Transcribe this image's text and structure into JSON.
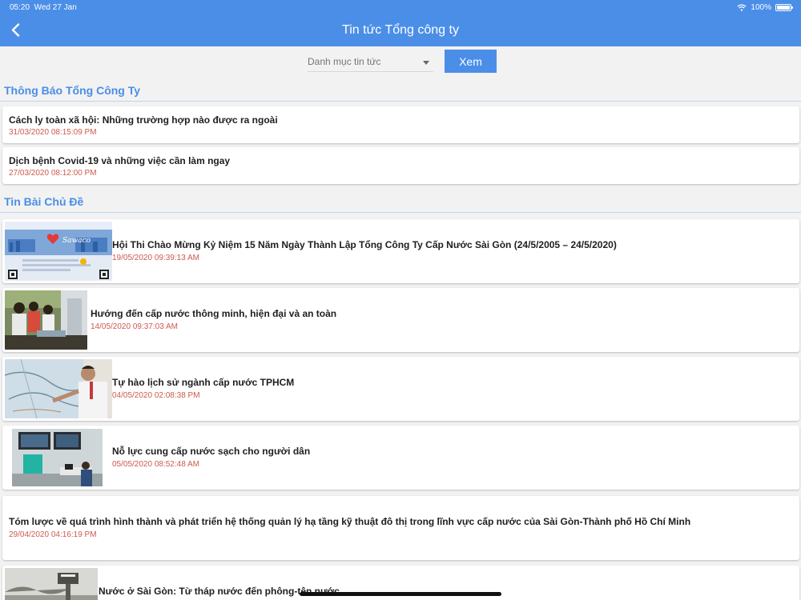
{
  "status": {
    "time": "05:20",
    "date": "Wed 27 Jan",
    "battery": "100%",
    "battery_level": 1.0
  },
  "nav": {
    "title": "Tin tức Tổng công ty"
  },
  "filter": {
    "category_placeholder": "Danh mục tin tức",
    "view_label": "Xem"
  },
  "notice_section": {
    "title": "Thông Báo Tổng Công Ty",
    "items": [
      {
        "title": "Cách ly toàn xã hội: Những trường hợp nào được ra ngoài",
        "date": "31/03/2020 08:15:09 PM"
      },
      {
        "title": "Dịch bệnh Covid-19 và những việc cần làm ngay",
        "date": "27/03/2020 08:12:00 PM"
      }
    ]
  },
  "topic_section": {
    "title": "Tin Bài Chủ Đề",
    "items": [
      {
        "title": "Hội Thi Chào Mừng Kỷ Niệm 15 Năm Ngày Thành Lập Tổng Công Ty Cấp Nước Sài Gòn (24/5/2005 – 24/5/2020)",
        "date": "19/05/2020 09:39:13 AM",
        "thumb_text": "Sawaco"
      },
      {
        "title": "Hướng đến cấp nước thông minh, hiện đại và an toàn",
        "date": "14/05/2020 09:37:03 AM"
      },
      {
        "title": "Tự hào lịch sử ngành cấp nước TPHCM",
        "date": "04/05/2020 02:08:38 PM"
      },
      {
        "title": "Nỗ lực cung cấp nước sạch cho người dân",
        "date": "05/05/2020 08:52:48 AM"
      },
      {
        "title": "Tóm lược về quá trình hình thành và phát triển hệ thống quản lý hạ tầng kỹ thuật đô thị trong lĩnh vực cấp nước của Sài Gòn-Thành phố Hồ Chí Minh",
        "date": "29/04/2020 04:16:19 PM"
      },
      {
        "title": "Nước ở Sài Gòn: Từ tháp nước đến phông-tên nước",
        "date": ""
      }
    ]
  }
}
